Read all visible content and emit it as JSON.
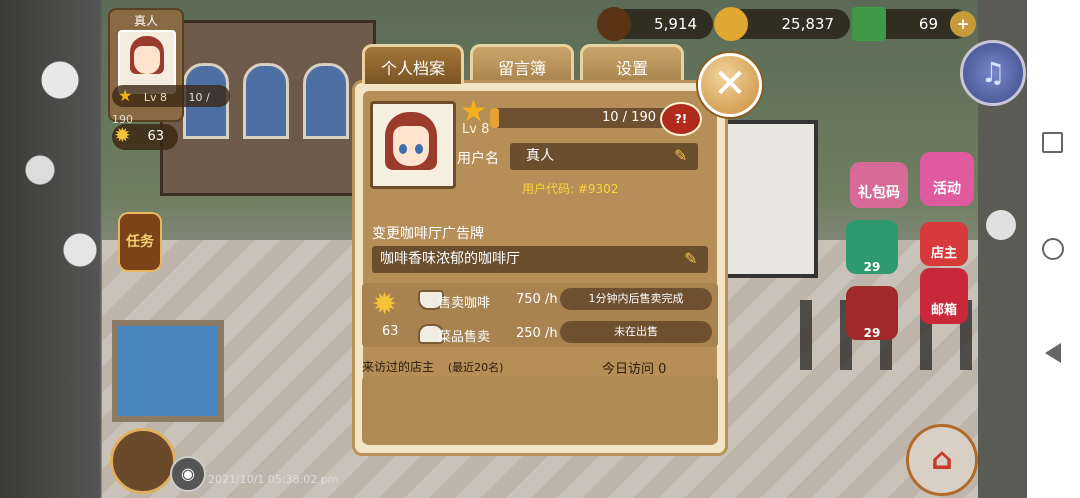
{
  "hud": {
    "coffee_beans": "5,914",
    "coins": "25,837",
    "cash": "69",
    "plus": "+"
  },
  "player": {
    "name": "真人",
    "level": "Lv 8",
    "xp": "10 / 190",
    "stars": "63"
  },
  "side_buttons": {
    "tasks": "任务",
    "gift_code": "礼包码",
    "events": "活动",
    "shop": "29",
    "coffee": "29",
    "mail": "邮箱",
    "owner": "店主"
  },
  "timestamp": "2021/10/1 05:38:02 pm",
  "tabs": [
    {
      "label": "个人档案",
      "active": true
    },
    {
      "label": "留言簿",
      "active": false
    },
    {
      "label": "设置",
      "active": false
    }
  ],
  "profile": {
    "level_label": "Lv 8",
    "xp_text": "10 / 190",
    "xp_fraction": 0.053,
    "xp_badge": "?!",
    "username_label": "用户名",
    "username_value": "真人",
    "user_code": "用户代码: #9302",
    "sign_label": "变更咖啡厅广告牌",
    "sign_value": "咖啡香味浓郁的咖啡厅"
  },
  "stats": {
    "star_count": "63",
    "coffee_label": "售卖咖啡",
    "coffee_rate": "750 /h",
    "coffee_status": "1分钟内后售卖完成",
    "food_label": "菜品售卖",
    "food_rate": "250 /h",
    "food_status": "未在出售"
  },
  "visitors": {
    "header": "来访过的店主",
    "note": "(最近20名)",
    "today": "今日访问  0"
  },
  "close_glyph": "✕",
  "colors": {
    "dialog_bg": "#f1e5c6",
    "panel_brown": "#b58e58",
    "field_brown": "#6b4e2e",
    "accent_gold": "#f6b11a",
    "user_code_yellow": "#ffd43a"
  }
}
